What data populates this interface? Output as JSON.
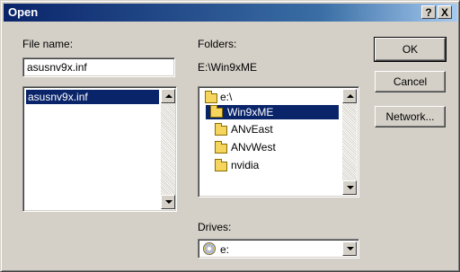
{
  "window": {
    "title": "Open",
    "help_label": "?",
    "close_label": "X"
  },
  "file_name": {
    "label": "File name:",
    "value": "asusnv9x.inf",
    "list": [
      "asusnv9x.inf"
    ]
  },
  "folders": {
    "label": "Folders:",
    "path": "E:\\Win9xME",
    "items": [
      {
        "label": "e:\\",
        "icon": "open-folder-icon",
        "selected": false
      },
      {
        "label": "Win9xME",
        "icon": "open-folder-icon",
        "selected": true
      },
      {
        "label": "ANvEast",
        "icon": "folder-icon",
        "selected": false
      },
      {
        "label": "ANvWest",
        "icon": "folder-icon",
        "selected": false
      },
      {
        "label": "nvidia",
        "icon": "folder-icon",
        "selected": false
      }
    ]
  },
  "drives": {
    "label": "Drives:",
    "value": "e:",
    "icon": "cd-drive-icon"
  },
  "buttons": {
    "ok": "OK",
    "cancel": "Cancel",
    "network": "Network..."
  },
  "colors": {
    "title_bar": "#0a246a",
    "selection": "#0a246a",
    "face": "#d4d0c8"
  }
}
